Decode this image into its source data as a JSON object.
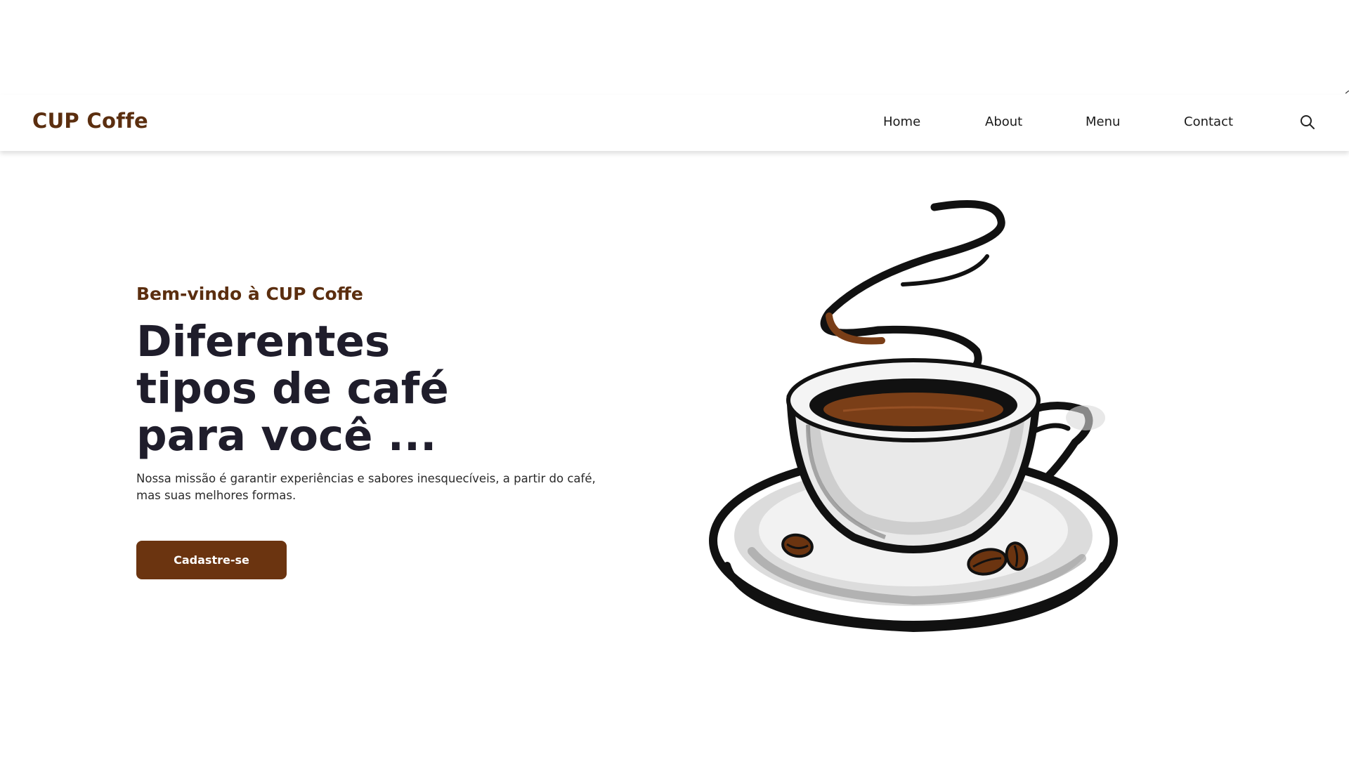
{
  "header": {
    "logo": "CUP Coffe",
    "nav": [
      "Home",
      "About",
      "Menu",
      "Contact"
    ],
    "search_icon": "search-icon"
  },
  "hero": {
    "welcome": "Bem-vindo à CUP Coffe",
    "title_lines": [
      "Diferentes",
      "tipos de café",
      "para você ..."
    ],
    "description": "Nossa missão é garantir experiências e sabores inesquecíveis, a partir do café, mas suas melhores formas.",
    "cta_label": "Cadastre-se"
  },
  "colors": {
    "brand_brown": "#5b2e0f",
    "button_brown": "#6b3410",
    "heading_dark": "#1f1d2b",
    "coffee": "#7a3e17"
  }
}
